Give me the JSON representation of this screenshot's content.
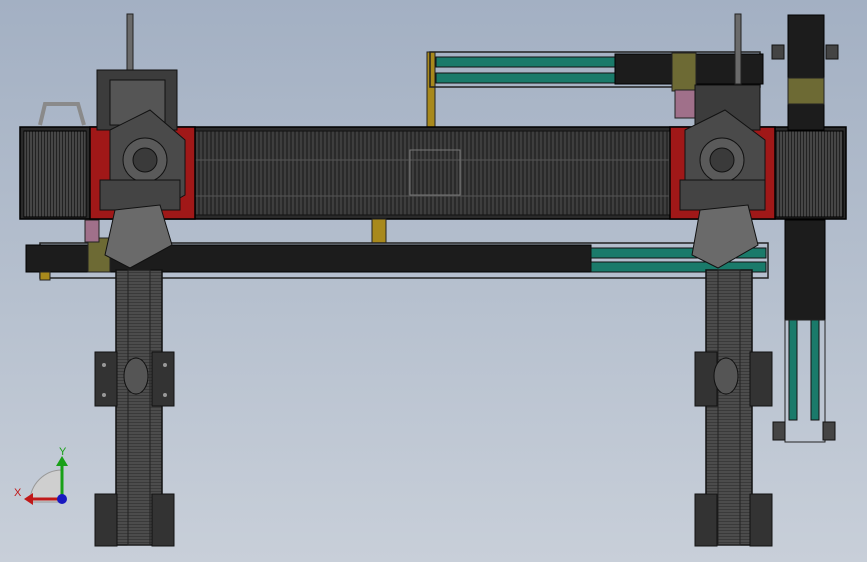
{
  "viewport": {
    "view": "top",
    "background": [
      "#a3b0c3",
      "#c8cfd9"
    ]
  },
  "palette": {
    "frame_black": "#1c1c1c",
    "frame_dark": "#2b2b2b",
    "frame_gray": "#3c3c3c",
    "teal": "#1a7a6a",
    "yellow": "#a8891c",
    "red": "#a01818",
    "olive": "#6d6a34",
    "pink": "#a0708a",
    "steel": "#6a6a6a"
  },
  "components": [
    "chain-conveyor",
    "left-robot-cell",
    "right-robot-cell",
    "top-teal-rail",
    "bottom-teal-rail",
    "left-vertical-track",
    "right-vertical-track",
    "right-feed-column"
  ],
  "triad": {
    "x_label": "X",
    "y_label": "Y",
    "x_color": "#c01818",
    "y_color": "#18a018",
    "origin_color": "#1818c0"
  }
}
